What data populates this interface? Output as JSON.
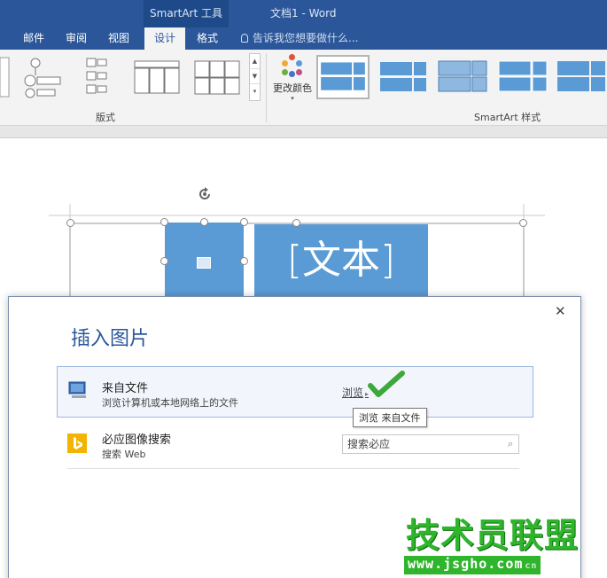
{
  "titlebar": {
    "tools_label": "SmartArt 工具",
    "doc_title": "文档1 - Word"
  },
  "tabs": [
    {
      "label": "邮件"
    },
    {
      "label": "审阅"
    },
    {
      "label": "视图"
    },
    {
      "label": "设计",
      "active": true
    },
    {
      "label": "格式"
    }
  ],
  "tellme": {
    "placeholder": "告诉我您想要做什么..."
  },
  "ribbon": {
    "layouts_group_label": "版式",
    "change_colors_label": "更改颜色",
    "styles_group_label": "SmartArt 样式"
  },
  "smartart": {
    "text_placeholder": "[文本]"
  },
  "dialog": {
    "title": "插入图片",
    "close_glyph": "✕",
    "from_file": {
      "title": "来自文件",
      "subtitle": "浏览计算机或本地网络上的文件",
      "browse_label": "浏览",
      "tooltip": "浏览 来自文件"
    },
    "bing": {
      "title": "必应图像搜索",
      "subtitle": "搜索 Web",
      "search_placeholder": "搜索必应"
    }
  },
  "watermark": {
    "main": "技术员联盟",
    "url": "www.jsgho.com",
    "small": "cn"
  },
  "colors": {
    "word_blue": "#2b579a",
    "smartart_blue": "#5b9bd5",
    "watermark_green": "#2fb52c"
  }
}
